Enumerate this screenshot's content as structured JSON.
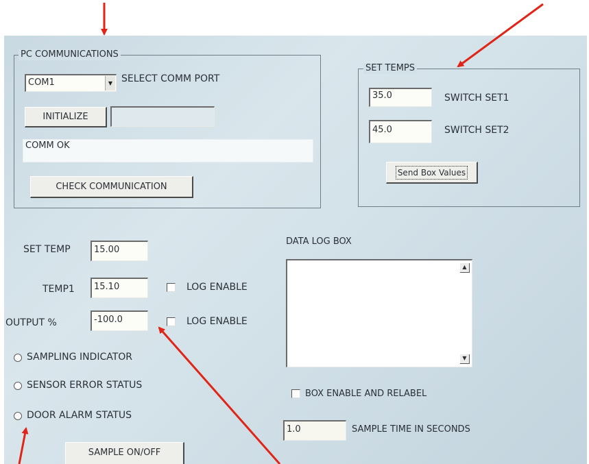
{
  "pc_comm": {
    "legend": "PC COMMUNICATIONS",
    "port_value": "COM1",
    "select_label": "SELECT COMM PORT",
    "init_label": "INITIALIZE",
    "init_status": "",
    "status_text": "COMM OK",
    "check_label": "CHECK COMMUNICATION"
  },
  "set_temps": {
    "legend": "SET TEMPS",
    "set1_value": "35.0",
    "set1_label": "SWITCH SET1",
    "set2_value": "45.0",
    "set2_label": "SWITCH SET2",
    "send_label": "Send Box Values"
  },
  "readings": {
    "set_temp_label": "SET TEMP",
    "set_temp_value": "15.00",
    "temp1_label": "TEMP1",
    "temp1_value": "15.10",
    "output_label": "OUTPUT %",
    "output_value": "-100.0",
    "log_enable_1": "LOG ENABLE",
    "log_enable_2": "LOG ENABLE"
  },
  "indicators": {
    "sampling": "SAMPLING INDICATOR",
    "sensor_error": "SENSOR ERROR STATUS",
    "door_alarm": "DOOR ALARM STATUS",
    "sample_btn": "SAMPLE ON/OFF"
  },
  "data_log": {
    "label": "DATA LOG BOX",
    "box_enable_label": "BOX ENABLE AND RELABEL",
    "sample_time_value": "1.0",
    "sample_time_label": "SAMPLE TIME IN SECONDS"
  },
  "colors": {
    "arrow": "#e02418",
    "panel": "#cfdde5"
  }
}
